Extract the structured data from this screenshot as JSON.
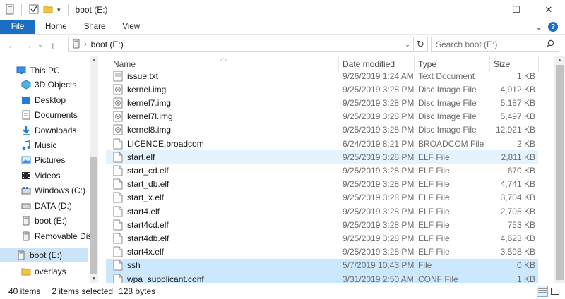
{
  "window": {
    "title": "boot (E:)",
    "controls": {
      "minimize": "—",
      "maximize": "☐",
      "close": "✕"
    }
  },
  "ribbon": {
    "tabs": [
      "File",
      "Home",
      "Share",
      "View"
    ],
    "collapse": "⌄",
    "help": "?"
  },
  "address": {
    "crumb": "boot (E:)",
    "search_placeholder": "Search boot (E:)"
  },
  "navpane": {
    "items": [
      {
        "label": "This PC",
        "icon": "pc-icon"
      },
      {
        "label": "3D Objects",
        "icon": "3d-objects-icon"
      },
      {
        "label": "Desktop",
        "icon": "desktop-icon"
      },
      {
        "label": "Documents",
        "icon": "documents-icon"
      },
      {
        "label": "Downloads",
        "icon": "downloads-icon"
      },
      {
        "label": "Music",
        "icon": "music-icon"
      },
      {
        "label": "Pictures",
        "icon": "pictures-icon"
      },
      {
        "label": "Videos",
        "icon": "videos-icon"
      },
      {
        "label": "Windows (C:)",
        "icon": "windows-drive-icon"
      },
      {
        "label": "DATA (D:)",
        "icon": "drive-icon"
      },
      {
        "label": "boot (E:)",
        "icon": "drive-icon"
      },
      {
        "label": "Removable Disk",
        "icon": "drive-icon"
      },
      {
        "label": "boot (E:)",
        "icon": "drive-icon"
      },
      {
        "label": "overlays",
        "icon": "folder-icon"
      }
    ]
  },
  "columns": {
    "name": "Name",
    "date": "Date modified",
    "type": "Type",
    "size": "Size"
  },
  "files": [
    {
      "name": "issue.txt",
      "date": "9/26/2019 1:24 AM",
      "type": "Text Document",
      "size": "1 KB",
      "icon": "text-file-icon"
    },
    {
      "name": "kernel.img",
      "date": "9/25/2019 3:28 PM",
      "type": "Disc Image File",
      "size": "4,912 KB",
      "icon": "disc-image-icon"
    },
    {
      "name": "kernel7.img",
      "date": "9/25/2019 3:28 PM",
      "type": "Disc Image File",
      "size": "5,187 KB",
      "icon": "disc-image-icon"
    },
    {
      "name": "kernel7l.img",
      "date": "9/25/2019 3:28 PM",
      "type": "Disc Image File",
      "size": "5,497 KB",
      "icon": "disc-image-icon"
    },
    {
      "name": "kernel8.img",
      "date": "9/25/2019 3:28 PM",
      "type": "Disc Image File",
      "size": "12,921 KB",
      "icon": "disc-image-icon"
    },
    {
      "name": "LICENCE.broadcom",
      "date": "6/24/2019 8:21 PM",
      "type": "BROADCOM File",
      "size": "2 KB",
      "icon": "file-icon"
    },
    {
      "name": "start.elf",
      "date": "9/25/2019 3:28 PM",
      "type": "ELF File",
      "size": "2,811 KB",
      "icon": "file-icon"
    },
    {
      "name": "start_cd.elf",
      "date": "9/25/2019 3:28 PM",
      "type": "ELF File",
      "size": "670 KB",
      "icon": "file-icon"
    },
    {
      "name": "start_db.elf",
      "date": "9/25/2019 3:28 PM",
      "type": "ELF File",
      "size": "4,741 KB",
      "icon": "file-icon"
    },
    {
      "name": "start_x.elf",
      "date": "9/25/2019 3:28 PM",
      "type": "ELF File",
      "size": "3,704 KB",
      "icon": "file-icon"
    },
    {
      "name": "start4.elf",
      "date": "9/25/2019 3:28 PM",
      "type": "ELF File",
      "size": "2,705 KB",
      "icon": "file-icon"
    },
    {
      "name": "start4cd.elf",
      "date": "9/25/2019 3:28 PM",
      "type": "ELF File",
      "size": "753 KB",
      "icon": "file-icon"
    },
    {
      "name": "start4db.elf",
      "date": "9/25/2019 3:28 PM",
      "type": "ELF File",
      "size": "4,623 KB",
      "icon": "file-icon"
    },
    {
      "name": "start4x.elf",
      "date": "9/25/2019 3:28 PM",
      "type": "ELF File",
      "size": "3,598 KB",
      "icon": "file-icon"
    },
    {
      "name": "ssh",
      "date": "5/7/2019 10:43 PM",
      "type": "File",
      "size": "0 KB",
      "icon": "file-icon"
    },
    {
      "name": "wpa_supplicant.conf",
      "date": "3/31/2019 2:50 AM",
      "type": "CONF File",
      "size": "1 KB",
      "icon": "file-icon"
    }
  ],
  "status": {
    "items": "40 items",
    "selected": "2 items selected",
    "size": "128 bytes"
  },
  "colors": {
    "accent": "#1a6fc4",
    "selection": "#cce8ff",
    "hover": "#e5f3ff"
  }
}
